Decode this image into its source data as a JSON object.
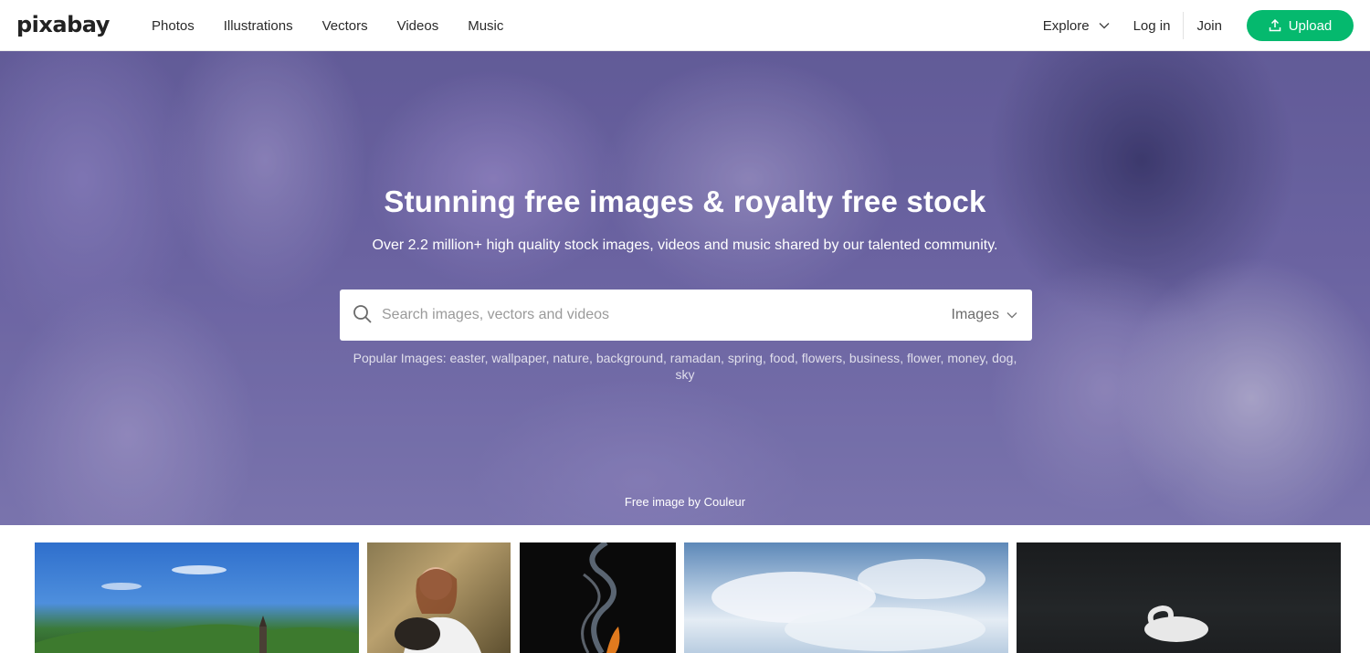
{
  "header": {
    "logo": "pixabay",
    "nav": [
      "Photos",
      "Illustrations",
      "Vectors",
      "Videos",
      "Music"
    ],
    "explore": "Explore",
    "login": "Log in",
    "join": "Join",
    "upload": "Upload"
  },
  "hero": {
    "title": "Stunning free images & royalty free stock",
    "subtitle": "Over 2.2 million+ high quality stock images, videos and music shared by our talented community.",
    "search_placeholder": "Search images, vectors and videos",
    "search_type": "Images",
    "popular_label": "Popular Images:",
    "popular_tags": [
      "easter",
      "wallpaper",
      "nature",
      "background",
      "ramadan",
      "spring",
      "food",
      "flowers",
      "business",
      "flower",
      "money",
      "dog",
      "sky"
    ],
    "credit": "Free image by Couleur"
  },
  "colors": {
    "brand_green": "#05b96e",
    "hero_purple": "#7a72b4"
  },
  "thumbnails": [
    "church-landscape",
    "woman-with-dog",
    "smoke-flame",
    "clouds-sky",
    "swan-dark-water"
  ]
}
